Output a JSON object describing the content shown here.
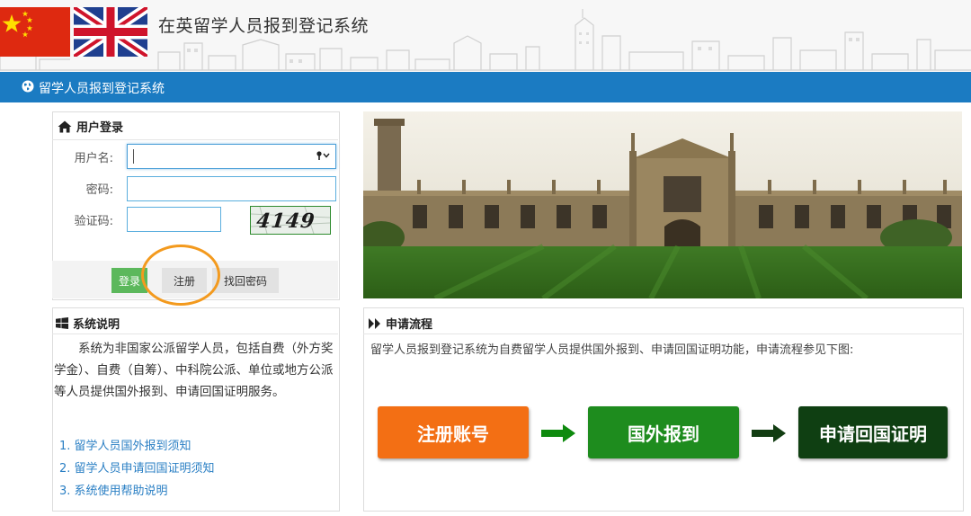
{
  "header": {
    "title": "在英留学人员报到登记系统"
  },
  "navbar": {
    "text": "留学人员报到登记系统"
  },
  "login": {
    "title": "用户登录",
    "username_label": "用户名:",
    "username_value": "",
    "password_label": "密码:",
    "password_value": "",
    "captcha_label": "验证码:",
    "captcha_value": "",
    "captcha_text": "4149",
    "login_button": "登录",
    "register_button": "注册",
    "forgot_button": "找回密码"
  },
  "system_info": {
    "title": "系统说明",
    "description": "系统为非国家公派留学人员，包括自费（外方奖学金）、自费（自筹）、中科院公派、单位或地方公派等人员提供国外报到、申请回国证明服务。",
    "links": [
      "1. 留学人员国外报到须知",
      "2. 留学人员申请回国证明须知",
      "3. 系统使用帮助说明"
    ]
  },
  "process": {
    "title": "申请流程",
    "text": "留学人员报到登记系统为自费留学人员提供国外报到、申请回国证明功能，申请流程参见下图:",
    "steps": [
      "注册账号",
      "国外报到",
      "申请回国证明"
    ]
  },
  "colors": {
    "nav_blue": "#1b7bc2",
    "step1": "#f36f14",
    "step2": "#1e8c1e",
    "step3": "#0f3f12",
    "arrow": "#0e8a0e",
    "highlight": "#f39a1e",
    "link": "#2a7fc4"
  },
  "icons": {
    "login_title": "home-icon",
    "info_title": "windows-icon",
    "process_title": "double-chevron-right-icon",
    "nav": "globe-icon",
    "username_field": "key-icon"
  }
}
